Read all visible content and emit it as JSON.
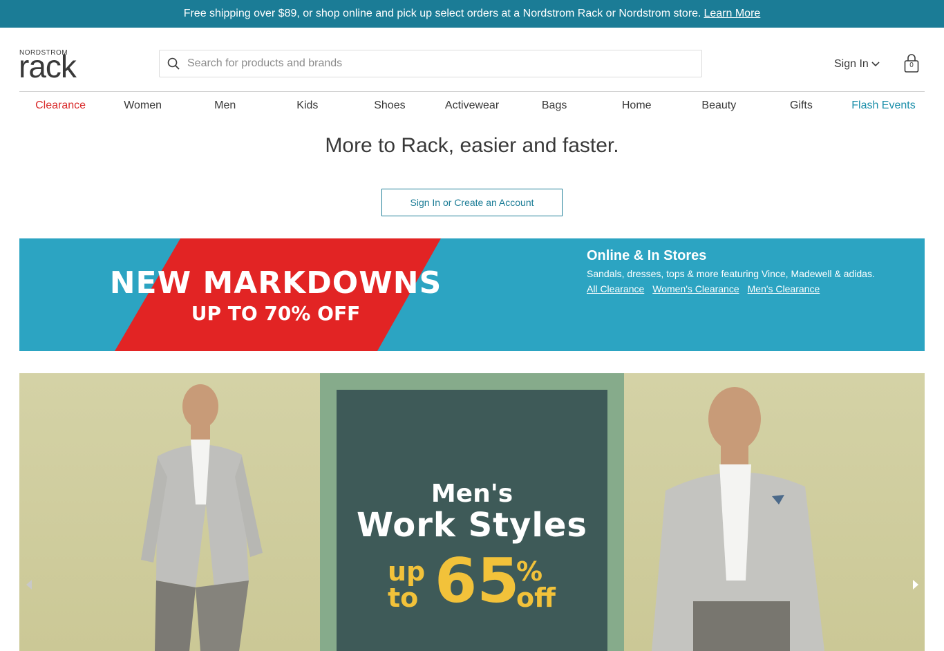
{
  "promo": {
    "text": "Free shipping over $89, or shop online and pick up select orders at a Nordstrom Rack or Nordstrom store.",
    "link": "Learn More"
  },
  "header": {
    "logo_small": "NORDSTROM",
    "logo_big": "rack",
    "search_placeholder": "Search for products and brands",
    "search_value": "",
    "sign_in": "Sign In",
    "bag_count": "0"
  },
  "nav": {
    "items": [
      "Clearance",
      "Women",
      "Men",
      "Kids",
      "Shoes",
      "Activewear",
      "Bags",
      "Home",
      "Beauty",
      "Gifts",
      "Flash Events"
    ]
  },
  "signin_prompt": {
    "headline": "More to Rack, easier and faster.",
    "button": "Sign In or Create an Account"
  },
  "markdowns": {
    "art_line1": "NEW MARKDOWNS",
    "art_line2": "UP TO 70% OFF",
    "title": "Online & In Stores",
    "subtitle": "Sandals, dresses, tops & more featuring Vince, Madewell & adidas.",
    "links": [
      "All Clearance",
      "Women's Clearance",
      "Men's Clearance"
    ]
  },
  "hero": {
    "line1": "Men's",
    "line2": "Work Styles",
    "up": "up",
    "to": "to",
    "number": "65",
    "percent": "%",
    "off": "off"
  },
  "colors": {
    "promo_bg": "#1b7c96",
    "banner_bg": "#2ca4c2",
    "banner_red": "#e22424",
    "clearance_red": "#d92a2a",
    "flash_teal": "#1a8ea9",
    "hero_panel": "#3e5a58",
    "hero_gold": "#f2c23a"
  },
  "icons": [
    "search-icon",
    "chevron-down-icon",
    "shopping-bag-icon",
    "chevron-left-icon",
    "chevron-right-icon"
  ]
}
